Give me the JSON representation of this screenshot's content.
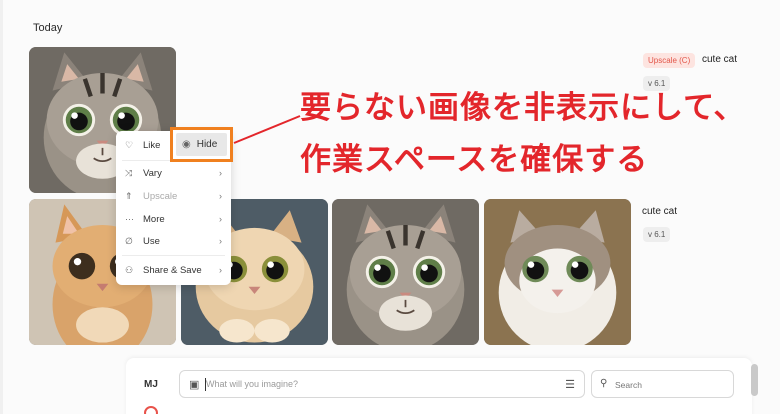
{
  "feed": {
    "section_label": "Today"
  },
  "jobs": [
    {
      "badge": "Upscale (C)",
      "prompt": "cute cat",
      "version": "v 6.1"
    },
    {
      "prompt": "cute cat",
      "version": "v 6.1"
    }
  ],
  "context_menu": {
    "items": [
      {
        "label": "Like",
        "icon": "heart-icon"
      },
      {
        "label": "Hide",
        "icon": "eye-icon"
      },
      {
        "label": "Vary",
        "icon": "shuffle-icon",
        "has_submenu": true
      },
      {
        "label": "Upscale",
        "icon": "upscale-icon",
        "has_submenu": true,
        "disabled": true
      },
      {
        "label": "More",
        "icon": "more-icon",
        "has_submenu": true
      },
      {
        "label": "Use",
        "icon": "paperclip-icon",
        "has_submenu": true
      },
      {
        "label": "Share & Save",
        "icon": "share-icon",
        "has_submenu": true
      }
    ]
  },
  "annotation": {
    "line1": "要らない画像を非表示にして、",
    "line2": "作業スペースを確保する"
  },
  "composer": {
    "label": "MJ",
    "prompt_placeholder": "What will you imagine?",
    "search_placeholder": "Search"
  },
  "colors": {
    "highlight": "#f0801f",
    "annotation": "#e3262b",
    "upscale_badge_text": "#e2564a",
    "upscale_badge_bg": "#fde4e0"
  }
}
